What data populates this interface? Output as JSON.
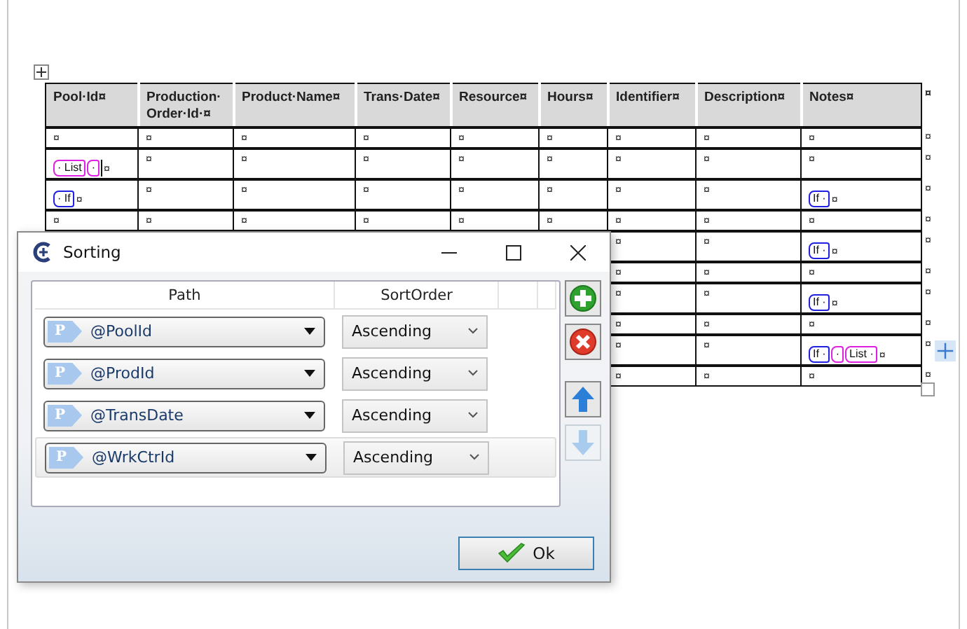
{
  "document": {
    "table": {
      "columns": [
        "Pool·Id¤",
        "Production·Order·Id·¤",
        "Product·Name¤",
        "Trans·Date¤",
        "Resource¤",
        "Hours¤",
        "Identifier¤",
        "Description¤",
        "Notes¤"
      ],
      "header_end_mark": "¤",
      "rows": [
        {
          "cells": [
            "¤",
            "¤",
            "¤",
            "¤",
            "¤",
            "¤",
            "¤",
            "¤",
            "¤"
          ],
          "end_mark": "¤"
        },
        {
          "cells": [
            {
              "tags": [
                {
                  "text": "· List",
                  "color": "#e020e0"
                },
                {
                  "text": "·",
                  "color": "#e020e0"
                }
              ],
              "cursor": true,
              "text": "¤"
            },
            "¤",
            "¤",
            "¤",
            "¤",
            "¤",
            "¤",
            "¤",
            "¤"
          ],
          "end_mark": "¤"
        },
        {
          "cells": [
            {
              "tags": [
                {
                  "text": "· If",
                  "color": "#2020e0"
                }
              ],
              "cursor": false,
              "text": "¤"
            },
            "¤",
            "¤",
            "¤",
            "¤",
            "¤",
            "¤",
            "¤",
            {
              "tags": [
                {
                  "text": "If ·",
                  "color": "#2020e0"
                }
              ],
              "cursor": false,
              "text": "¤"
            }
          ],
          "end_mark": "¤"
        },
        {
          "cells": [
            "¤",
            "¤",
            "¤",
            "¤",
            "¤",
            "¤",
            "¤",
            "¤",
            "¤"
          ],
          "end_mark": "¤"
        },
        {
          "cells": [
            "¤",
            "¤",
            {
              "tags": [
                {
                  "text": "If ·",
                  "color": "#2020e0"
                }
              ],
              "cursor": false,
              "text": "¤"
            }
          ],
          "end_mark": "¤"
        },
        {
          "cells": [
            "¤",
            "¤",
            "¤"
          ],
          "end_mark": "¤"
        },
        {
          "cells": [
            "¤",
            "¤",
            {
              "tags": [
                {
                  "text": "If ·",
                  "color": "#2020e0"
                }
              ],
              "cursor": false,
              "text": "¤"
            }
          ],
          "end_mark": "¤"
        },
        {
          "cells": [
            "¤",
            "¤",
            "¤"
          ],
          "end_mark": "¤"
        },
        {
          "cells": [
            "¤",
            "¤",
            {
              "tags": [
                {
                  "text": "If ·",
                  "color": "#2020e0"
                },
                {
                  "text": "·",
                  "color": "#e020e0"
                },
                {
                  "text": "List ·",
                  "color": "#e020e0"
                }
              ],
              "cursor": false,
              "text": "¤"
            }
          ],
          "end_mark": "¤"
        },
        {
          "cells": [
            "¤",
            "¤",
            "¤"
          ],
          "end_mark": "¤"
        }
      ]
    }
  },
  "dialog": {
    "title": "Sorting",
    "columns": [
      "Path",
      "SortOrder"
    ],
    "rows": [
      {
        "badge": "P",
        "path": "@PoolId",
        "sort_order": "Ascending",
        "selected": false
      },
      {
        "badge": "P",
        "path": "@ProdId",
        "sort_order": "Ascending",
        "selected": false
      },
      {
        "badge": "P",
        "path": "@TransDate",
        "sort_order": "Ascending",
        "selected": false
      },
      {
        "badge": "P",
        "path": "@WrkCtrId",
        "sort_order": "Ascending",
        "selected": true
      }
    ],
    "side_buttons": [
      {
        "kind": "add",
        "disabled": false
      },
      {
        "kind": "remove",
        "disabled": false
      },
      {
        "kind": "up",
        "disabled": false
      },
      {
        "kind": "down",
        "disabled": true
      }
    ],
    "ok_button": "Ok"
  }
}
